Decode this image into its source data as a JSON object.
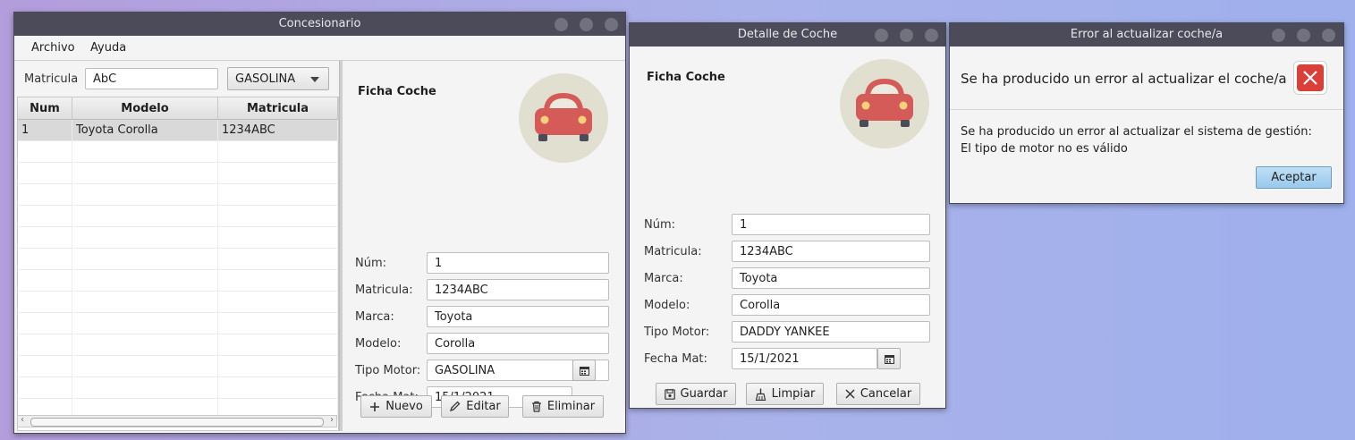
{
  "main_window": {
    "title": "Concesionario",
    "menu": [
      "Archivo",
      "Ayuda"
    ],
    "filter": {
      "label": "Matricula",
      "value": "AbC",
      "combo_value": "GASOLINA"
    },
    "table": {
      "headers": [
        "Num",
        "Modelo",
        "Matricula"
      ],
      "rows": [
        {
          "num": "1",
          "modelo": "Toyota Corolla",
          "matricula": "1234ABC"
        }
      ]
    },
    "ficha": {
      "title": "Ficha Coche",
      "fields": [
        {
          "label": "Núm:",
          "value": "1"
        },
        {
          "label": "Matricula:",
          "value": "1234ABC"
        },
        {
          "label": "Marca:",
          "value": "Toyota"
        },
        {
          "label": "Modelo:",
          "value": "Corolla"
        },
        {
          "label": "Tipo Motor:",
          "value": "GASOLINA"
        },
        {
          "label": "Fecha Mat:",
          "value": "15/1/2021"
        }
      ],
      "buttons": {
        "nuevo": "Nuevo",
        "editar": "Editar",
        "eliminar": "Eliminar"
      }
    }
  },
  "detail_window": {
    "title": "Detalle de Coche",
    "heading": "Ficha Coche",
    "fields": [
      {
        "label": "Núm:",
        "value": "1"
      },
      {
        "label": "Matricula:",
        "value": "1234ABC"
      },
      {
        "label": "Marca:",
        "value": "Toyota"
      },
      {
        "label": "Modelo:",
        "value": "Corolla"
      },
      {
        "label": "Tipo Motor:",
        "value": "DADDY YANKEE"
      },
      {
        "label": "Fecha Mat:",
        "value": "15/1/2021"
      }
    ],
    "buttons": {
      "guardar": "Guardar",
      "limpiar": "Limpiar",
      "cancelar": "Cancelar"
    }
  },
  "error_dialog": {
    "title": "Error al actualizar coche/a",
    "header": "Se ha producido un error al actualizar el coche/a",
    "message_line1": "Se ha producido un error al actualizar el sistema de gestión:",
    "message_line2": "El tipo de motor no es válido",
    "ok_button": "Aceptar"
  },
  "colors": {
    "titlebar": "#4b4b5a",
    "car": "#d45b58",
    "error_red": "#d9403a",
    "accent_button": "#a9d3f0"
  },
  "icons": [
    "car-icon",
    "calendar-icon",
    "plus-icon",
    "pencil-icon",
    "trash-icon",
    "save-icon",
    "broom-icon",
    "x-icon",
    "error-icon"
  ]
}
